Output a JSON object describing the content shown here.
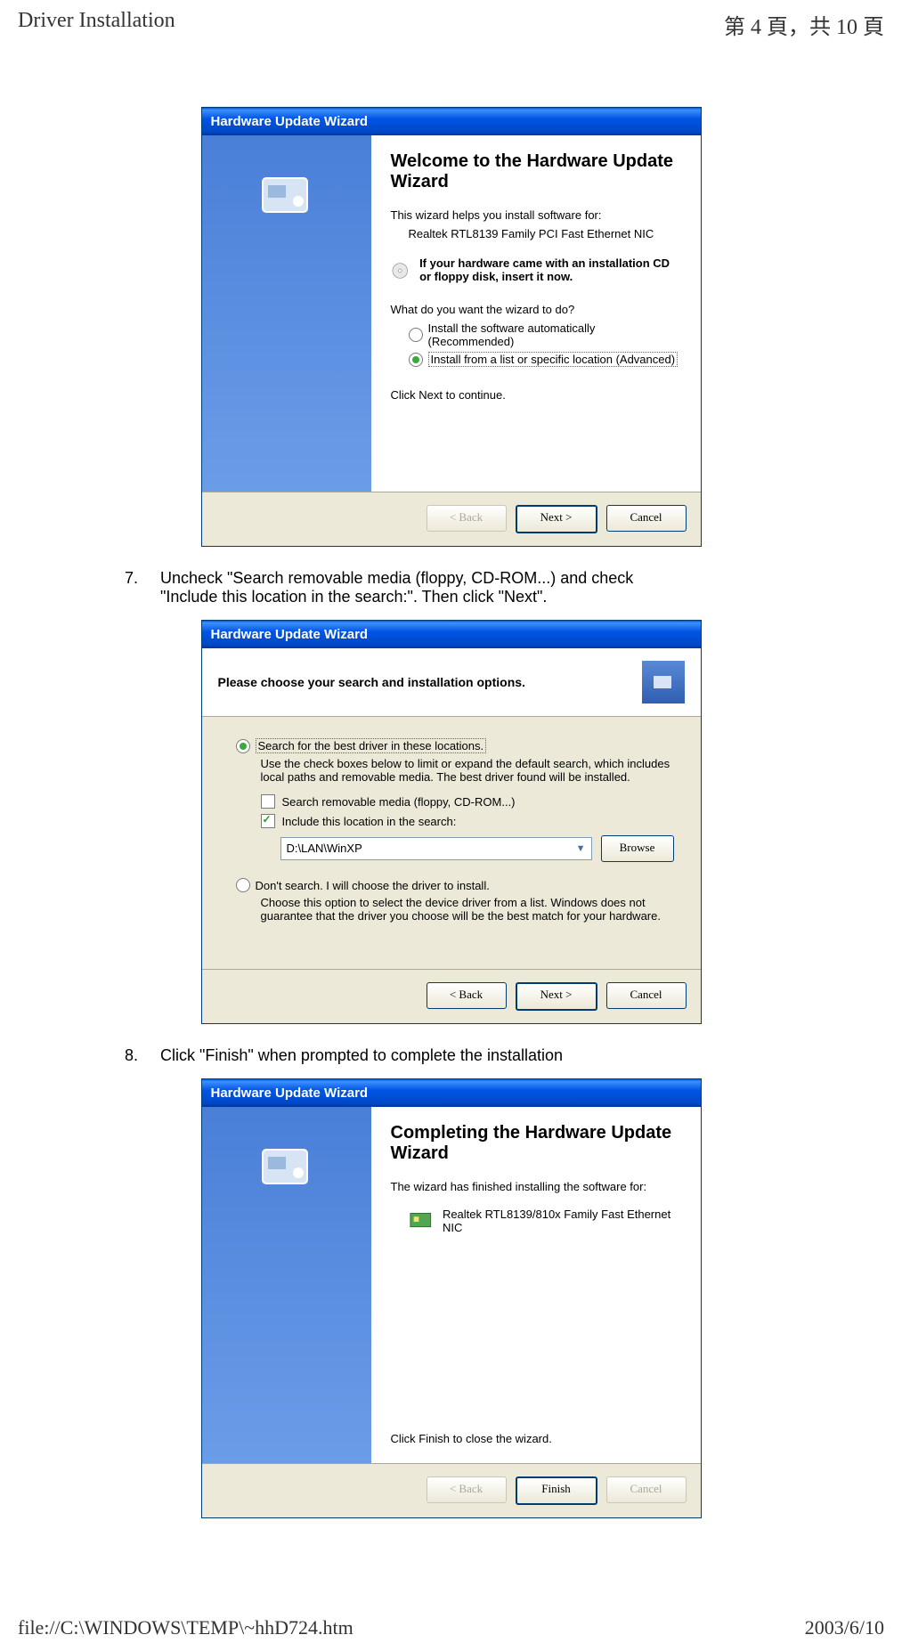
{
  "header": {
    "left": "Driver Installation",
    "right": "第 4 頁，共 10 頁"
  },
  "steps": {
    "s7num": "7.",
    "s7text": "Uncheck \"Search removable media (floppy, CD-ROM...) and check \"Include this location in the search:\". Then click \"Next\".",
    "s8num": "8.",
    "s8text": "Click \"Finish\" when prompted to complete the installation"
  },
  "wizard1": {
    "titlebar": "Hardware Update Wizard",
    "title": "Welcome to the Hardware Update Wizard",
    "help1": "This wizard helps you install software for:",
    "device": "Realtek RTL8139 Family PCI Fast Ethernet NIC",
    "cd_text": "If your hardware came with an installation CD or floppy disk, insert it now.",
    "prompt": "What do you want the wizard to do?",
    "opt1": "Install the software automatically (Recommended)",
    "opt2": "Install from a list or specific location (Advanced)",
    "cont": "Click Next to continue.",
    "back": "< Back",
    "next": "Next >",
    "cancel": "Cancel"
  },
  "wizard2": {
    "titlebar": "Hardware Update Wizard",
    "head": "Please choose your search and installation options.",
    "opt1": "Search for the best driver in these locations.",
    "desc1": "Use the check boxes below to limit or expand the default search, which includes local paths and removable media. The best driver found will be installed.",
    "cb1": "Search removable media (floppy, CD-ROM...)",
    "cb2": "Include this location in the search:",
    "path": "D:\\LAN\\WinXP",
    "browse": "Browse",
    "opt2": "Don't search. I will choose the driver to install.",
    "desc2": "Choose this option to select the device driver from a list.  Windows does not guarantee that the driver you choose will be the best match for your hardware.",
    "back": "< Back",
    "next": "Next >",
    "cancel": "Cancel"
  },
  "wizard3": {
    "titlebar": "Hardware Update Wizard",
    "title": "Completing the Hardware Update Wizard",
    "done": "The wizard has finished installing the software for:",
    "device": "Realtek RTL8139/810x Family Fast Ethernet NIC",
    "close": "Click Finish to close the wizard.",
    "back": "< Back",
    "finish": "Finish",
    "cancel": "Cancel"
  },
  "footer": {
    "left": "file://C:\\WINDOWS\\TEMP\\~hhD724.htm",
    "right": "2003/6/10"
  }
}
